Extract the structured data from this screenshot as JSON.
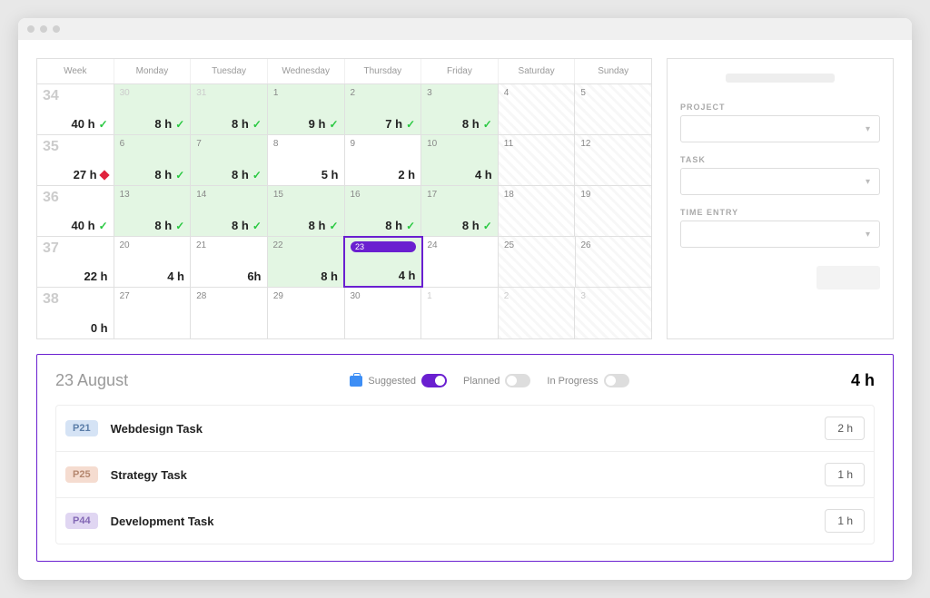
{
  "calendar": {
    "headers": [
      "Week",
      "Monday",
      "Tuesday",
      "Wednesday",
      "Thursday",
      "Friday",
      "Saturday",
      "Sunday"
    ],
    "weeks": [
      {
        "num": "34",
        "total": "40 h",
        "status": "check",
        "days": [
          {
            "date": "30",
            "hours": "8 h",
            "bg": "green",
            "check": true,
            "muted": true
          },
          {
            "date": "31",
            "hours": "8 h",
            "bg": "green",
            "check": true,
            "muted": true
          },
          {
            "date": "1",
            "hours": "9 h",
            "bg": "green",
            "check": true
          },
          {
            "date": "2",
            "hours": "7 h",
            "bg": "green",
            "check": true
          },
          {
            "date": "3",
            "hours": "8 h",
            "bg": "green",
            "check": true
          },
          {
            "date": "4",
            "hours": "",
            "bg": "hatched"
          },
          {
            "date": "5",
            "hours": "",
            "bg": "hatched"
          }
        ]
      },
      {
        "num": "35",
        "total": "27 h",
        "status": "diamond",
        "days": [
          {
            "date": "6",
            "hours": "8 h",
            "bg": "green",
            "check": true
          },
          {
            "date": "7",
            "hours": "8 h",
            "bg": "green",
            "check": true
          },
          {
            "date": "8",
            "hours": "5 h",
            "bg": "white"
          },
          {
            "date": "9",
            "hours": "2 h",
            "bg": "white"
          },
          {
            "date": "10",
            "hours": "4 h",
            "bg": "green"
          },
          {
            "date": "11",
            "hours": "",
            "bg": "hatched"
          },
          {
            "date": "12",
            "hours": "",
            "bg": "hatched"
          }
        ]
      },
      {
        "num": "36",
        "total": "40 h",
        "status": "check",
        "days": [
          {
            "date": "13",
            "hours": "8 h",
            "bg": "green",
            "check": true
          },
          {
            "date": "14",
            "hours": "8 h",
            "bg": "green",
            "check": true
          },
          {
            "date": "15",
            "hours": "8 h",
            "bg": "green",
            "check": true
          },
          {
            "date": "16",
            "hours": "8 h",
            "bg": "green",
            "check": true
          },
          {
            "date": "17",
            "hours": "8 h",
            "bg": "green",
            "check": true
          },
          {
            "date": "18",
            "hours": "",
            "bg": "hatched"
          },
          {
            "date": "19",
            "hours": "",
            "bg": "hatched"
          }
        ]
      },
      {
        "num": "37",
        "total": "22 h",
        "status": "",
        "days": [
          {
            "date": "20",
            "hours": "4 h",
            "bg": "white"
          },
          {
            "date": "21",
            "hours": "6h",
            "bg": "white"
          },
          {
            "date": "22",
            "hours": "8 h",
            "bg": "green"
          },
          {
            "date": "23",
            "hours": "4 h",
            "bg": "green",
            "selected": true,
            "today": true
          },
          {
            "date": "24",
            "hours": "",
            "bg": "white"
          },
          {
            "date": "25",
            "hours": "",
            "bg": "hatched"
          },
          {
            "date": "26",
            "hours": "",
            "bg": "hatched"
          }
        ]
      },
      {
        "num": "38",
        "total": "0 h",
        "status": "",
        "days": [
          {
            "date": "27",
            "hours": "",
            "bg": "white"
          },
          {
            "date": "28",
            "hours": "",
            "bg": "white"
          },
          {
            "date": "29",
            "hours": "",
            "bg": "white"
          },
          {
            "date": "30",
            "hours": "",
            "bg": "white"
          },
          {
            "date": "1",
            "hours": "",
            "bg": "white",
            "muted": true
          },
          {
            "date": "2",
            "hours": "",
            "bg": "hatched",
            "muted": true
          },
          {
            "date": "3",
            "hours": "",
            "bg": "hatched",
            "muted": true
          }
        ]
      }
    ]
  },
  "sidebar": {
    "project_label": "PROJECT",
    "task_label": "TASK",
    "entry_label": "TIME ENTRY"
  },
  "detail": {
    "date": "23 August",
    "total": "4 h",
    "filters": {
      "suggested": "Suggested",
      "planned": "Planned",
      "inprogress": "In Progress"
    },
    "tasks": [
      {
        "badge": "P21",
        "badgeColor": "blue",
        "name": "Webdesign Task",
        "hours": "2 h"
      },
      {
        "badge": "P25",
        "badgeColor": "peach",
        "name": "Strategy Task",
        "hours": "1 h"
      },
      {
        "badge": "P44",
        "badgeColor": "purple",
        "name": "Development Task",
        "hours": "1 h"
      }
    ]
  }
}
